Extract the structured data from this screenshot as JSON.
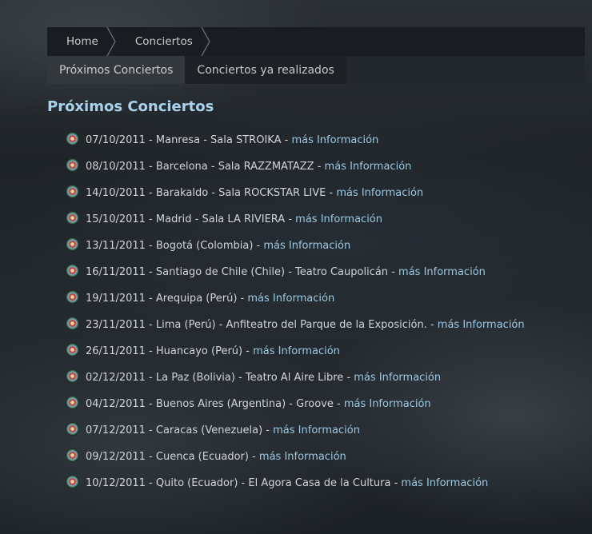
{
  "breadcrumb": {
    "items": [
      {
        "label": "Home"
      },
      {
        "label": "Conciertos"
      }
    ]
  },
  "tabs": [
    {
      "label": "Próximos Conciertos",
      "active": true
    },
    {
      "label": "Conciertos ya realizados",
      "active": false
    }
  ],
  "page": {
    "title": "Próximos Conciertos"
  },
  "link_label": "más Información",
  "separator": " - ",
  "concerts": [
    {
      "text": "07/10/2011 - Manresa - Sala STROIKA"
    },
    {
      "text": "08/10/2011 - Barcelona - Sala RAZZMATAZZ"
    },
    {
      "text": "14/10/2011 - Barakaldo - Sala ROCKSTAR LIVE"
    },
    {
      "text": "15/10/2011 - Madrid - Sala LA RIVIERA"
    },
    {
      "text": "13/11/2011 - Bogotá (Colombia)"
    },
    {
      "text": "16/11/2011 - Santiago de Chile (Chile) - Teatro Caupolicán"
    },
    {
      "text": "19/11/2011 - Arequipa (Perú)"
    },
    {
      "text": "23/11/2011 - Lima (Perú) - Anfiteatro del Parque de la Exposición."
    },
    {
      "text": "26/11/2011 - Huancayo (Perú)"
    },
    {
      "text": "02/12/2011 - La Paz (Bolivia) - Teatro Al Aire Libre"
    },
    {
      "text": "04/12/2011 - Buenos Aires (Argentina) - Groove"
    },
    {
      "text": "07/12/2011 - Caracas (Venezuela)"
    },
    {
      "text": "09/12/2011 - Cuenca (Ecuador)"
    },
    {
      "text": "10/12/2011 - Quito (Ecuador) - El Agora Casa de la Cultura"
    }
  ],
  "icons": {
    "bullet": "flower-bullet-icon",
    "separator": "chevron-separator-icon"
  },
  "colors": {
    "title": "#a9d3ec",
    "link": "#9cc9e2",
    "text": "#d2d5d7"
  }
}
